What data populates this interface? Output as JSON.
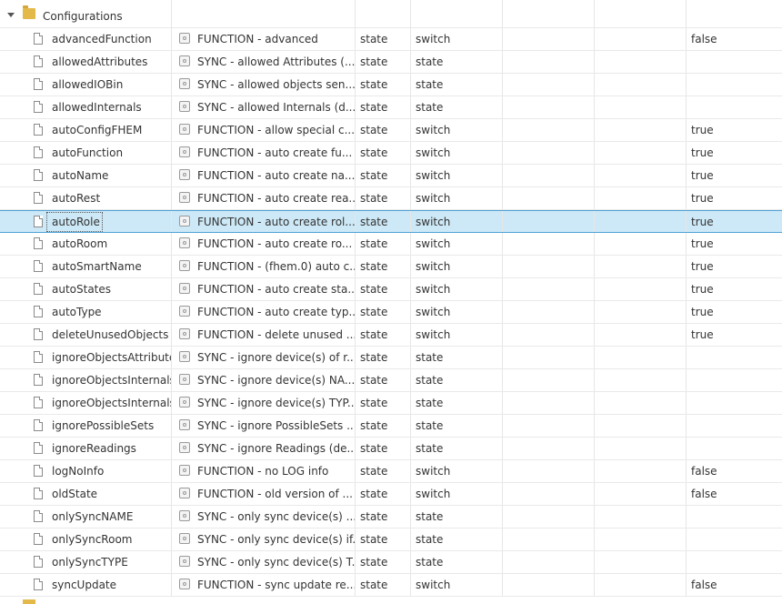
{
  "folder": {
    "title": "Configurations"
  },
  "rows": [
    {
      "name": "advancedFunction",
      "desc": "FUNCTION - advanced",
      "role": "state",
      "type": "switch",
      "value": "false"
    },
    {
      "name": "allowedAttributes",
      "desc": "SYNC - allowed Attributes (...",
      "role": "state",
      "type": "state",
      "value": ""
    },
    {
      "name": "allowedIOBin",
      "desc": "SYNC - allowed objects sen...",
      "role": "state",
      "type": "state",
      "value": ""
    },
    {
      "name": "allowedInternals",
      "desc": "SYNC - allowed Internals (d...",
      "role": "state",
      "type": "state",
      "value": ""
    },
    {
      "name": "autoConfigFHEM",
      "desc": "FUNCTION - allow special c...",
      "role": "state",
      "type": "switch",
      "value": "true"
    },
    {
      "name": "autoFunction",
      "desc": "FUNCTION - auto create fu...",
      "role": "state",
      "type": "switch",
      "value": "true"
    },
    {
      "name": "autoName",
      "desc": "FUNCTION - auto create na...",
      "role": "state",
      "type": "switch",
      "value": "true"
    },
    {
      "name": "autoRest",
      "desc": "FUNCTION - auto create rea...",
      "role": "state",
      "type": "switch",
      "value": "true"
    },
    {
      "name": "autoRole",
      "desc": "FUNCTION - auto create rol...",
      "role": "state",
      "type": "switch",
      "value": "true",
      "selected": true
    },
    {
      "name": "autoRoom",
      "desc": "FUNCTION - auto create ro...",
      "role": "state",
      "type": "switch",
      "value": "true"
    },
    {
      "name": "autoSmartName",
      "desc": "FUNCTION - (fhem.0) auto c...",
      "role": "state",
      "type": "switch",
      "value": "true"
    },
    {
      "name": "autoStates",
      "desc": "FUNCTION - auto create sta...",
      "role": "state",
      "type": "switch",
      "value": "true"
    },
    {
      "name": "autoType",
      "desc": "FUNCTION - auto create typ...",
      "role": "state",
      "type": "switch",
      "value": "true"
    },
    {
      "name": "deleteUnusedObjects",
      "desc": "FUNCTION - delete unused ...",
      "role": "state",
      "type": "switch",
      "value": "true"
    },
    {
      "name": "ignoreObjectsAttributes",
      "desc": "SYNC - ignore device(s) of r...",
      "role": "state",
      "type": "state",
      "value": ""
    },
    {
      "name": "ignoreObjectsInternalsNAME",
      "desc": "SYNC - ignore device(s) NA...",
      "role": "state",
      "type": "state",
      "value": ""
    },
    {
      "name": "ignoreObjectsInternalsTYPE",
      "desc": "SYNC - ignore device(s) TYP...",
      "role": "state",
      "type": "state",
      "value": ""
    },
    {
      "name": "ignorePossibleSets",
      "desc": "SYNC - ignore PossibleSets ...",
      "role": "state",
      "type": "state",
      "value": ""
    },
    {
      "name": "ignoreReadings",
      "desc": "SYNC - ignore Readings (de...",
      "role": "state",
      "type": "state",
      "value": ""
    },
    {
      "name": "logNoInfo",
      "desc": "FUNCTION - no LOG info",
      "role": "state",
      "type": "switch",
      "value": "false"
    },
    {
      "name": "oldState",
      "desc": "FUNCTION - old version of ...",
      "role": "state",
      "type": "switch",
      "value": "false"
    },
    {
      "name": "onlySyncNAME",
      "desc": "SYNC - only sync device(s) ...",
      "role": "state",
      "type": "state",
      "value": ""
    },
    {
      "name": "onlySyncRoom",
      "desc": "SYNC - only sync device(s) if...",
      "role": "state",
      "type": "state",
      "value": ""
    },
    {
      "name": "onlySyncTYPE",
      "desc": "SYNC - only sync device(s) T...",
      "role": "state",
      "type": "state",
      "value": ""
    },
    {
      "name": "syncUpdate",
      "desc": "FUNCTION - sync update re...",
      "role": "state",
      "type": "switch",
      "value": "false"
    }
  ]
}
